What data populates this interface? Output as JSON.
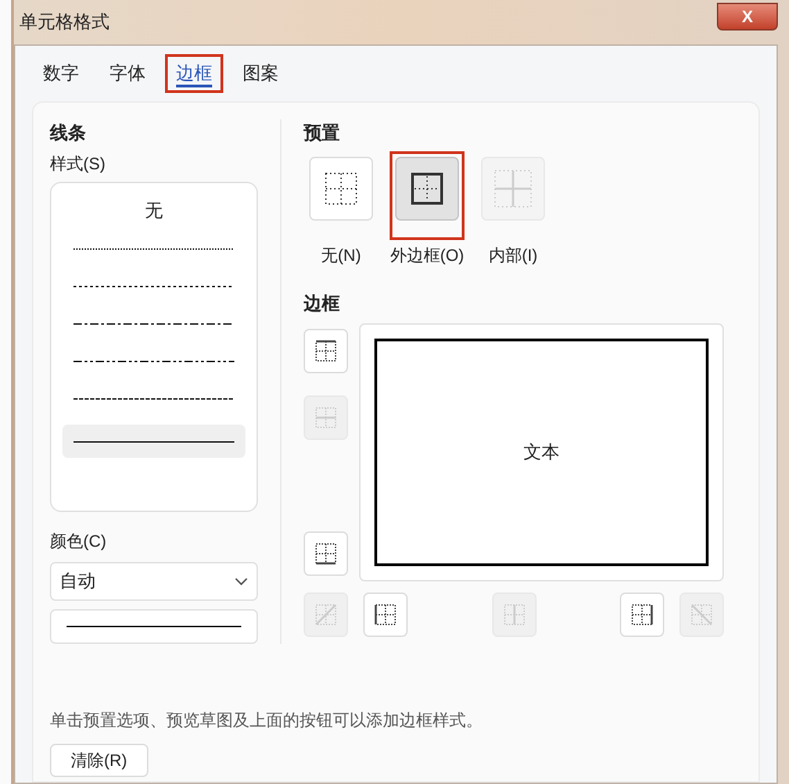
{
  "window": {
    "title": "单元格格式",
    "close_label": "X"
  },
  "tabs": [
    {
      "label": "数字",
      "selected": false,
      "highlighted": false
    },
    {
      "label": "字体",
      "selected": false,
      "highlighted": false
    },
    {
      "label": "边框",
      "selected": true,
      "highlighted": true
    },
    {
      "label": "图案",
      "selected": false,
      "highlighted": false
    }
  ],
  "line": {
    "title": "线条",
    "style_label": "样式(S)",
    "styles": [
      {
        "kind": "none",
        "label": "无",
        "selected": false
      },
      {
        "kind": "dotted",
        "selected": false
      },
      {
        "kind": "dashed",
        "selected": false
      },
      {
        "kind": "dash_dot",
        "selected": false
      },
      {
        "kind": "dash_dot_dot",
        "selected": false
      },
      {
        "kind": "fine_dashed",
        "selected": false
      },
      {
        "kind": "solid",
        "selected": true
      }
    ],
    "color_label": "颜色(C)",
    "color_value": "自动"
  },
  "presets": {
    "title": "预置",
    "items": [
      {
        "kind": "none",
        "label": "无(N)",
        "selected": false,
        "highlighted": false,
        "disabled": false
      },
      {
        "kind": "outline",
        "label": "外边框(O)",
        "selected": true,
        "highlighted": true,
        "disabled": false
      },
      {
        "kind": "inside",
        "label": "内部(I)",
        "selected": false,
        "highlighted": false,
        "disabled": true
      }
    ]
  },
  "border": {
    "title": "边框",
    "preview_text": "文本",
    "side_buttons": [
      {
        "kind": "top",
        "disabled": false
      },
      {
        "kind": "inner_horizontal",
        "disabled": true
      },
      {
        "kind": "bottom",
        "disabled": false
      }
    ],
    "bottom_buttons": [
      {
        "kind": "diagonal_up",
        "disabled": true
      },
      {
        "kind": "left",
        "disabled": false
      },
      {
        "kind": "inner_vertical",
        "disabled": true
      },
      {
        "kind": "right",
        "disabled": false
      },
      {
        "kind": "diagonal_down",
        "disabled": true
      }
    ]
  },
  "hint": "单击预置选项、预览草图及上面的按钮可以添加边框样式。",
  "clear_button": "清除(R)"
}
